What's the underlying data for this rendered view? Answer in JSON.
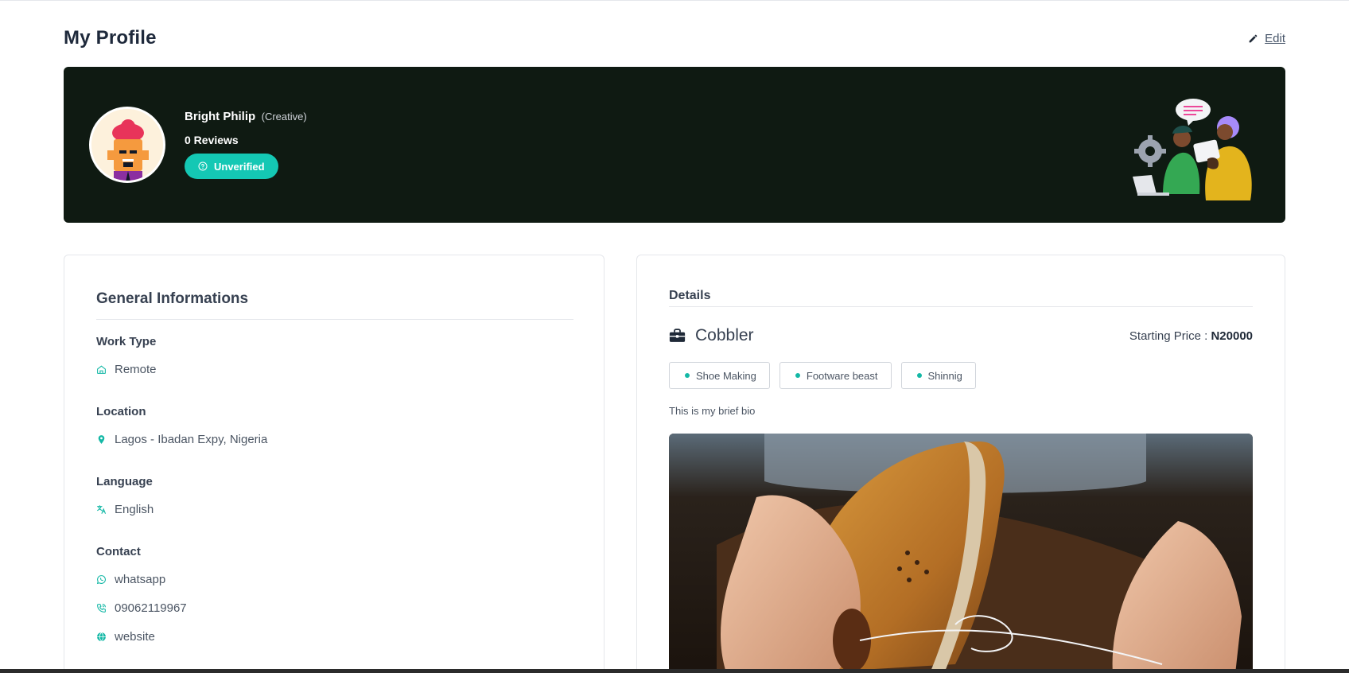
{
  "page": {
    "title": "My Profile",
    "edit_label": "Edit"
  },
  "profile": {
    "name": "Bright Philip",
    "role": "(Creative)",
    "reviews": "0 Reviews",
    "status": "Unverified",
    "status_color": "#14c8b4",
    "banner_color": "#0f1a12"
  },
  "general": {
    "title": "General Informations",
    "work_type": {
      "label": "Work Type",
      "value": "Remote",
      "icon": "home-icon"
    },
    "location": {
      "label": "Location",
      "value": "Lagos - Ibadan Expy, Nigeria",
      "icon": "map-pin-icon"
    },
    "language": {
      "label": "Language",
      "value": "English",
      "icon": "translate-icon"
    },
    "contact": {
      "label": "Contact",
      "items": [
        {
          "value": "whatsapp",
          "icon": "whatsapp-icon"
        },
        {
          "value": "09062119967",
          "icon": "phone-icon"
        },
        {
          "value": "website",
          "icon": "globe-icon"
        }
      ]
    }
  },
  "details": {
    "title": "Details",
    "service": "Cobbler",
    "service_icon": "briefcase-icon",
    "price_label": "Starting Price : ",
    "price_value": "N20000",
    "tags": [
      "Shoe Making",
      "Footware beast",
      "Shinnig"
    ],
    "bio": "This is my brief bio"
  },
  "colors": {
    "accent": "#14b8a6",
    "text_dark": "#1e293b"
  }
}
